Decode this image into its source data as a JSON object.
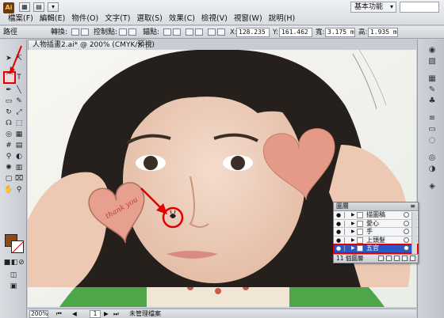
{
  "app": {
    "logo_text": "Ai",
    "workspace": "基本功能"
  },
  "menu": {
    "items": [
      "檔案(F)",
      "編輯(E)",
      "物件(O)",
      "文字(T)",
      "選取(S)",
      "效果(C)",
      "檢視(V)",
      "視窗(W)",
      "說明(H)"
    ]
  },
  "control_bar": {
    "path_label": "路徑",
    "transform_label": "轉換:",
    "anchor_label": "控制點:",
    "handle_label": "錨點:",
    "x_label": "X:",
    "x_value": "128.235 mr",
    "y_label": "Y:",
    "y_value": "161.462 mr",
    "w_label": "寬:",
    "w_value": "3.175 mm",
    "h_label": "高:",
    "h_value": "1.935 mm"
  },
  "document": {
    "tab_title": "人物插畫2.ai* @ 200% (CMYK/預視)",
    "close_glyph": "×"
  },
  "status": {
    "zoom": "200%",
    "page": "1",
    "status_text": "未管理檔案"
  },
  "layers_panel": {
    "title": "圖層",
    "menu_glyph": "≡",
    "layers": [
      {
        "name": "描圖稿",
        "active": false
      },
      {
        "name": "愛心",
        "active": false
      },
      {
        "name": "手",
        "active": false
      },
      {
        "name": "上頭髮",
        "active": false
      },
      {
        "name": "五官",
        "active": true
      }
    ],
    "footer": "11 個圖層"
  },
  "canvas": {
    "left_heart_text": "thank you",
    "highlight_color": "#e00000",
    "hair_color": "#26201c",
    "heart_color": "#e7a08d"
  }
}
